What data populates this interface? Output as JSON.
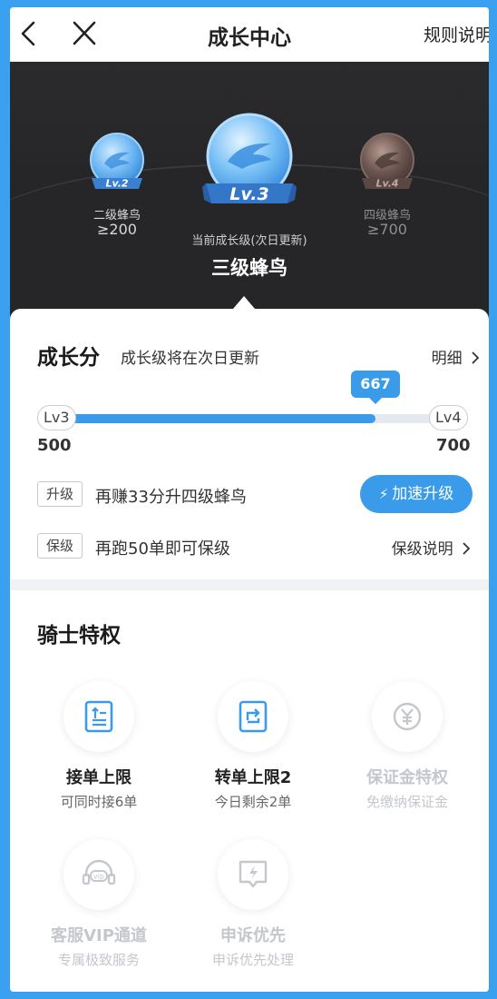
{
  "nav": {
    "title": "成长中心",
    "rules": "规则说明"
  },
  "hero": {
    "prev_badge": {
      "level": "Lv.2",
      "name": "二级蜂鸟",
      "threshold": "≥200"
    },
    "current_badge": {
      "level": "Lv.3",
      "caption": "当前成长级(次日更新)",
      "name": "三级蜂鸟"
    },
    "next_badge": {
      "level": "Lv.4",
      "name": "四级蜂鸟",
      "threshold": "≥700"
    }
  },
  "growth": {
    "title": "成长分",
    "subtitle": "成长级将在次日更新",
    "detail": "明细",
    "score": "667",
    "progress_fraction": 0.834,
    "start_level": "Lv3",
    "end_level": "Lv4",
    "start_value": "500",
    "end_value": "700",
    "upgrade_tag": "升级",
    "upgrade_text": "再赚33分升四级蜂鸟",
    "boost_button": "加速升级",
    "keep_tag": "保级",
    "keep_text": "再跑50单即可保级",
    "keep_link": "保级说明"
  },
  "privileges": {
    "title": "骑士特权",
    "items": [
      {
        "name": "接单上限",
        "desc": "可同时接6单",
        "icon": "order-limit-icon",
        "active": true
      },
      {
        "name": "转单上限2",
        "desc": "今日剩余2单",
        "icon": "transfer-icon",
        "active": true
      },
      {
        "name": "保证金特权",
        "desc": "免缴纳保证金",
        "icon": "deposit-icon",
        "active": false
      },
      {
        "name": "客服VIP通道",
        "desc": "专属极致服务",
        "icon": "vip-headset-icon",
        "active": false
      },
      {
        "name": "申诉优先",
        "desc": "申诉优先处理",
        "icon": "appeal-icon",
        "active": false
      }
    ]
  },
  "colors": {
    "accent": "#3a9bea",
    "frame": "#3aa0f0",
    "hero_bg": "#262628"
  }
}
